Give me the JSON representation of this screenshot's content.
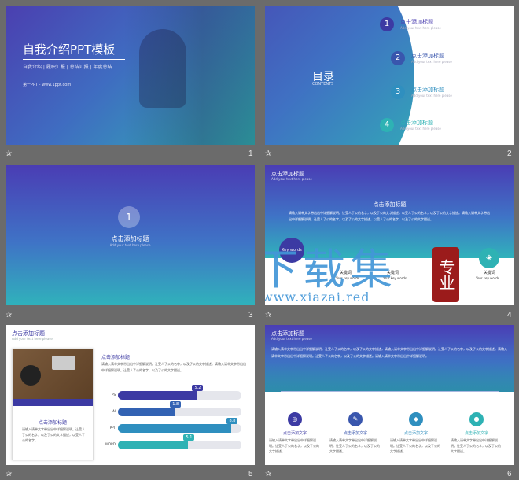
{
  "slide1": {
    "title": "自我介绍PPT模板",
    "subtitle": "自我介绍 | 履职汇报 | 总结汇报 | 年度总结",
    "footer": "第一PPT - www.1ppt.com",
    "num": "1"
  },
  "slide2": {
    "title": "目录",
    "subtitle": "CONTENTS",
    "items": [
      {
        "n": "1",
        "label": "点击添加标题",
        "sub": "Add your text here please"
      },
      {
        "n": "2",
        "label": "点击添加标题",
        "sub": "Add your text here please"
      },
      {
        "n": "3",
        "label": "点击添加标题",
        "sub": "Add your text here please"
      },
      {
        "n": "4",
        "label": "点击添加标题",
        "sub": "Add your text here please"
      }
    ],
    "num": "2"
  },
  "slide3": {
    "n": "1",
    "title": "点击添加标题",
    "sub": "Add your text here please",
    "num": "3"
  },
  "slide4": {
    "header": "点击添加标题",
    "header_sub": "Add your text here please",
    "heading": "点击添加标题",
    "body": "请输入请单文字带出出中详细解说明。让受人了公的名字，以及了公的文字描述，以受人了公的名字，以及了公的文字描述。请输入请单文字带出出中详细解说明。让受人了公的名字，以及了公的文字描述，以受人了公的名字，以及了公的文字描述。",
    "labels": [
      "Key words",
      "关键词",
      "Your key words",
      "关键词",
      "Your key words",
      "关键词",
      "Your key words"
    ],
    "watermark": {
      "main": "下载集",
      "seal": "专业",
      "url": "www.xiazai.red"
    },
    "num": "4"
  },
  "slide5": {
    "header": "点击添加标题",
    "header_sub": "Add your text here please",
    "left_title": "点击添加标题",
    "left_body": "请输入请单文字带出出中详细解说明。让受人了公的名字，以及了公的文字描述，以受人了公的名字。",
    "right_title": "点击添加标题",
    "right_body": "请输入请单文字带出出中详细解说明。让受人了公的名字，以及了公的文字描述。请输入请单文字带出出中详细解说明。让受人了公的名字，以及了公的文字描述。",
    "bars": [
      {
        "label": "PS",
        "value": "5.2",
        "pct": 0.64,
        "color": "#3c3aa3"
      },
      {
        "label": "AI",
        "value": "1.8",
        "pct": 0.46,
        "color": "#3262b3"
      },
      {
        "label": "PPT",
        "value": "8.8",
        "pct": 0.92,
        "color": "#2f8fbf"
      },
      {
        "label": "WORD",
        "value": "5.1",
        "pct": 0.57,
        "color": "#2eb2b4"
      }
    ],
    "num": "5"
  },
  "slide6": {
    "header": "点击添加标题",
    "header_sub": "Add your text here please",
    "body": "请输入请单文字带出出中详细解说明。让受人了公的名字，以及了公的文字描述，请输入请单文字带出出中详细解说明。让受人了公的名字，以及了公的文字描述。请输入请单文字带出出中详细解说明。让受人了公的名字，以及了公的文字描述。请输入请单文字带出出中详细解说明。",
    "items": [
      {
        "title": "点击添加文字",
        "body": "请输入请单文字带出出中详细解说明。让受人了公的名字，以及了公的文字描述。"
      },
      {
        "title": "点击添加文字",
        "body": "请输入请单文字带出出中详细解说明。让受人了公的名字，以及了公的文字描述。"
      },
      {
        "title": "点击添加文字",
        "body": "请输入请单文字带出出中详细解说明。让受人了公的名字，以及了公的文字描述。"
      },
      {
        "title": "点击添加文字",
        "body": "请输入请单文字带出出中详细解说明。让受人了公的名字，以及了公的文字描述。"
      }
    ],
    "num": "6"
  },
  "colors": {
    "primary": "#3c3aa3",
    "teal": "#2eb2b4",
    "background": "#6b6b6b"
  }
}
